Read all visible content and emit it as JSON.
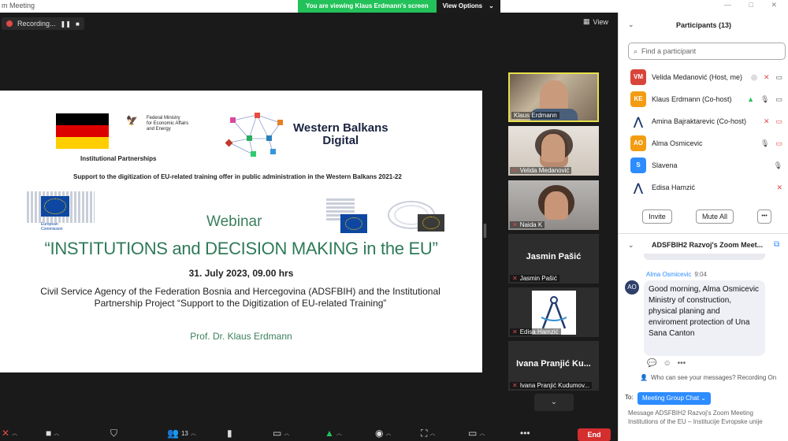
{
  "window": {
    "title": "m Meeting",
    "controls": "— □ ✕"
  },
  "banner": {
    "viewing": "You are viewing Klaus Erdmann's screen",
    "options": "View Options",
    "options_caret": "⌄"
  },
  "recording": {
    "label": "Recording...",
    "pause": "❚❚",
    "stop": "■"
  },
  "view": {
    "label": "View"
  },
  "slide": {
    "ministry": "Federal Ministry\nfor Economic Affairs\nand Energy",
    "inst_partnerships": "Institutional Partnerships",
    "wb_title": "Western Balkans\nDigital",
    "support": "Support to the digitization of EU-related training offer in public administration in the Western Balkans 2021-22",
    "eu_commission": "European\nCommission",
    "webinar": "Webinar",
    "main_title": "“INSTITUTIONS and DECISION MAKING in the EU”",
    "date": "31. July 2023, 09.00 hrs",
    "description": "Civil Service Agency of the Federation Bosnia and Hercegovina (ADSFBIH) and the Institutional Partnership Project “Support to the Digitization of EU-related Training”",
    "professor": "Prof. Dr. Klaus Erdmann"
  },
  "tiles": [
    {
      "name": "Klaus Erdmann",
      "muted": false,
      "active": true,
      "big": ""
    },
    {
      "name": "Velida Medanović",
      "muted": true,
      "active": false,
      "big": ""
    },
    {
      "name": "Naida K",
      "muted": true,
      "active": false,
      "big": ""
    },
    {
      "name": "Jasmin Pašić",
      "muted": true,
      "active": false,
      "big": "Jasmin Pašić"
    },
    {
      "name": "Edisa Hamzić",
      "muted": true,
      "active": false,
      "big": ""
    },
    {
      "name": "Ivana Pranjić Kudumov...",
      "muted": true,
      "active": false,
      "big": "Ivana Pranjić Ku..."
    }
  ],
  "tiles_more": "⌄",
  "toolbar": {
    "participants_count": "13",
    "end": "End"
  },
  "participants": {
    "title": "Participants (13)",
    "search_placeholder": "Find a participant",
    "list": [
      {
        "initials": "VM",
        "color": "#d9443a",
        "name": "Velida Medanović (Host, me)"
      },
      {
        "initials": "KE",
        "color": "#f39c12",
        "name": "Klaus Erdmann (Co-host)"
      },
      {
        "initials": "",
        "color": "",
        "name": "Amina Bajraktarevic (Co-host)"
      },
      {
        "initials": "AO",
        "color": "#f39c12",
        "name": "Alma Osmicevic"
      },
      {
        "initials": "S",
        "color": "#2d8cff",
        "name": "Slavena"
      },
      {
        "initials": "",
        "color": "",
        "name": "Edisa Hamzić"
      }
    ],
    "invite": "Invite",
    "mute_all": "Mute All",
    "more": "•••"
  },
  "chat": {
    "title": "ADSFBIH2 Razvoj's Zoom Meet...",
    "sender": "Alma Osmicevic",
    "time": "9:04",
    "avatar": "AO",
    "message": "Good morning, Alma Osmicevic Ministry of construction, physical planing and enviroment protection of Una Sana Canton",
    "who_can_see": "Who can see your messages? Recording On",
    "to_label": "To:",
    "to_value": "Meeting Group Chat ⌄",
    "placeholder": "Message ADSFBIH2 Razvoj's Zoom Meeting Institutions of the EU – Institucije Evropske unije"
  }
}
